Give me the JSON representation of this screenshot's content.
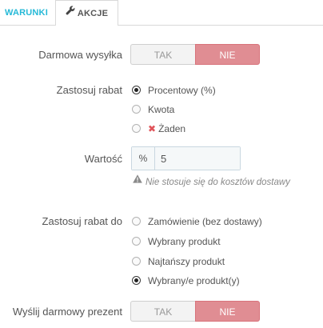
{
  "tabs": [
    {
      "label": "WARUNKI",
      "active": false
    },
    {
      "label": "AKCJE",
      "active": true,
      "icon": "wrench-icon"
    }
  ],
  "free_shipping": {
    "label": "Darmowa wysyłka",
    "yes": "TAK",
    "no": "NIE",
    "selected": "NIE"
  },
  "apply_discount": {
    "label": "Zastosuj rabat",
    "options": [
      {
        "label": "Procentowy (%)",
        "checked": true
      },
      {
        "label": "Kwota",
        "checked": false
      },
      {
        "label": "Żaden",
        "checked": false,
        "icon": "x-icon"
      }
    ]
  },
  "value": {
    "label": "Wartość",
    "prefix": "%",
    "value": "5",
    "help": "Nie stosuje się do kosztów dostawy",
    "help_icon": "warning-icon"
  },
  "apply_discount_to": {
    "label": "Zastosuj rabat do",
    "options": [
      {
        "label": "Zamówienie (bez dostawy)",
        "checked": false
      },
      {
        "label": "Wybrany produkt",
        "checked": false
      },
      {
        "label": "Najtańszy produkt",
        "checked": false
      },
      {
        "label": "Wybrany/e produkt(y)",
        "checked": true
      }
    ]
  },
  "free_gift": {
    "label": "Wyślij darmowy prezent",
    "yes": "TAK",
    "no": "NIE",
    "selected": "NIE"
  },
  "colors": {
    "accent": "#25b9d7",
    "no_active": "#e08d93",
    "danger": "#e0545a"
  }
}
